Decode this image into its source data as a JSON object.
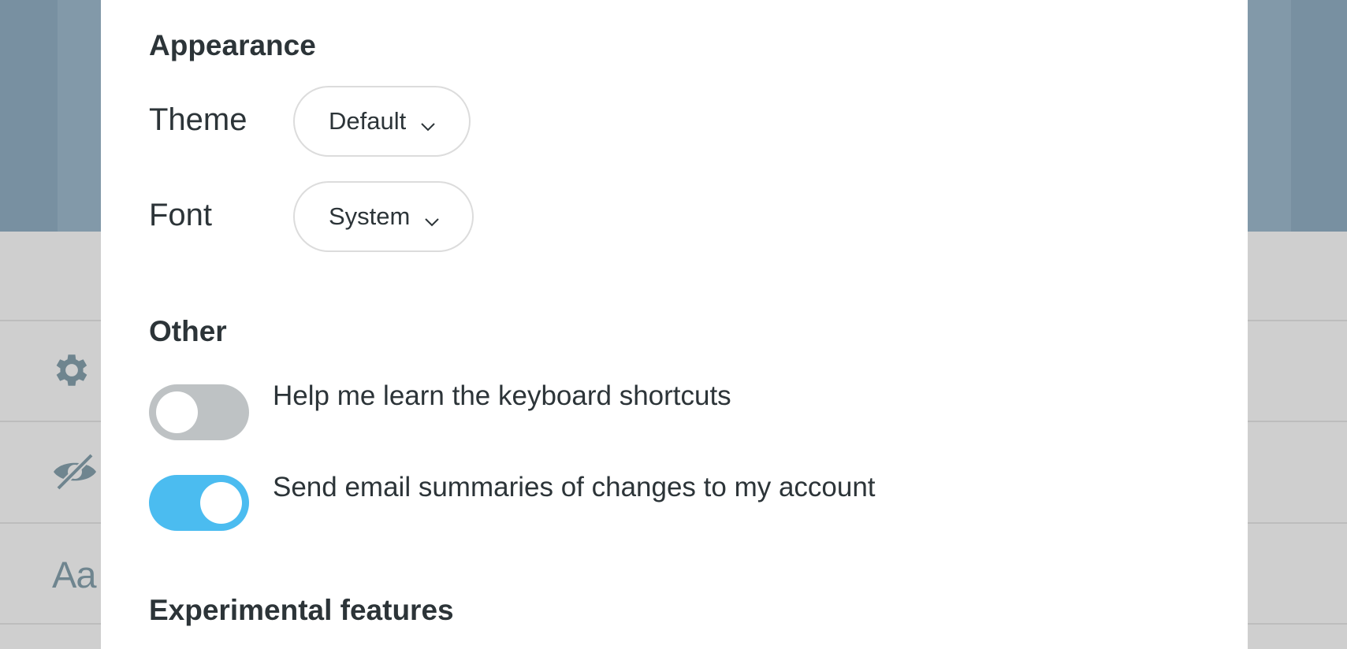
{
  "background": {
    "icons": [
      "gear-icon",
      "eye-slash-icon"
    ],
    "font_icon_text": "Aa"
  },
  "appearance": {
    "title": "Appearance",
    "theme": {
      "label": "Theme",
      "value": "Default"
    },
    "font": {
      "label": "Font",
      "value": "System"
    }
  },
  "other": {
    "title": "Other",
    "toggles": [
      {
        "label": "Help me learn the keyboard shortcuts",
        "checked": false
      },
      {
        "label": "Send email summaries of changes to my account",
        "checked": true
      }
    ]
  },
  "experimental": {
    "title": "Experimental features"
  },
  "colors": {
    "toggle_on": "#4bbcf0",
    "toggle_off": "#bec2c4",
    "header_bg": "#7890a1"
  }
}
